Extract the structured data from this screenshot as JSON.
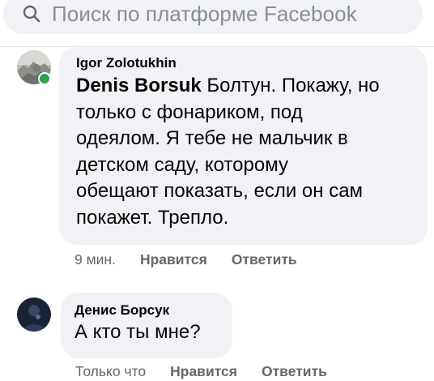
{
  "search": {
    "placeholder": "Поиск по платформе Facebook",
    "icon": "search-icon"
  },
  "comments": [
    {
      "author": "Igor Zolotukhin",
      "online": true,
      "mention": "Denis Borsuk",
      "lines": [
        " Болтун. Покажу, но",
        "только с фонариком, под",
        "одеялом. Я тебе не мальчик в",
        "детском саду, которому",
        "обещают показать, если он сам",
        "покажет. Трепло."
      ],
      "time": "9 мин.",
      "like_label": "Нравится",
      "reply_label": "Ответить"
    },
    {
      "author": "Денис Борсук",
      "online": false,
      "text": "А кто ты мне?",
      "time": "Только что",
      "like_label": "Нравится",
      "reply_label": "Ответить"
    }
  ],
  "colors": {
    "bubble": "#f0f2f5",
    "meta_text": "#65676b",
    "online": "#31a24c",
    "search_bg": "#f0f2f5"
  }
}
